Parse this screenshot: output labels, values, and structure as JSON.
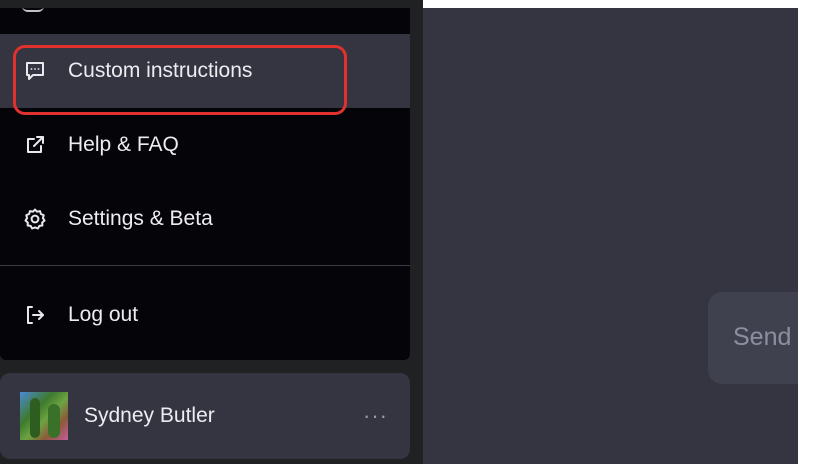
{
  "menu": {
    "items": [
      {
        "label": "Custom instructions",
        "icon": "chat-bubble-dots-icon"
      },
      {
        "label": "Help & FAQ",
        "icon": "external-link-icon"
      },
      {
        "label": "Settings & Beta",
        "icon": "gear-icon"
      },
      {
        "label": "Log out",
        "icon": "logout-icon"
      }
    ],
    "highlighted_item": "Custom instructions"
  },
  "profile": {
    "name": "Sydney Butler",
    "more": "···"
  },
  "composer": {
    "send_placeholder": "Send"
  },
  "colors": {
    "sidebar": "#202123",
    "menu": "#050509",
    "active_item": "#343541",
    "main": "#343541",
    "highlight_border": "#e0312f",
    "text": "#ececf1"
  }
}
